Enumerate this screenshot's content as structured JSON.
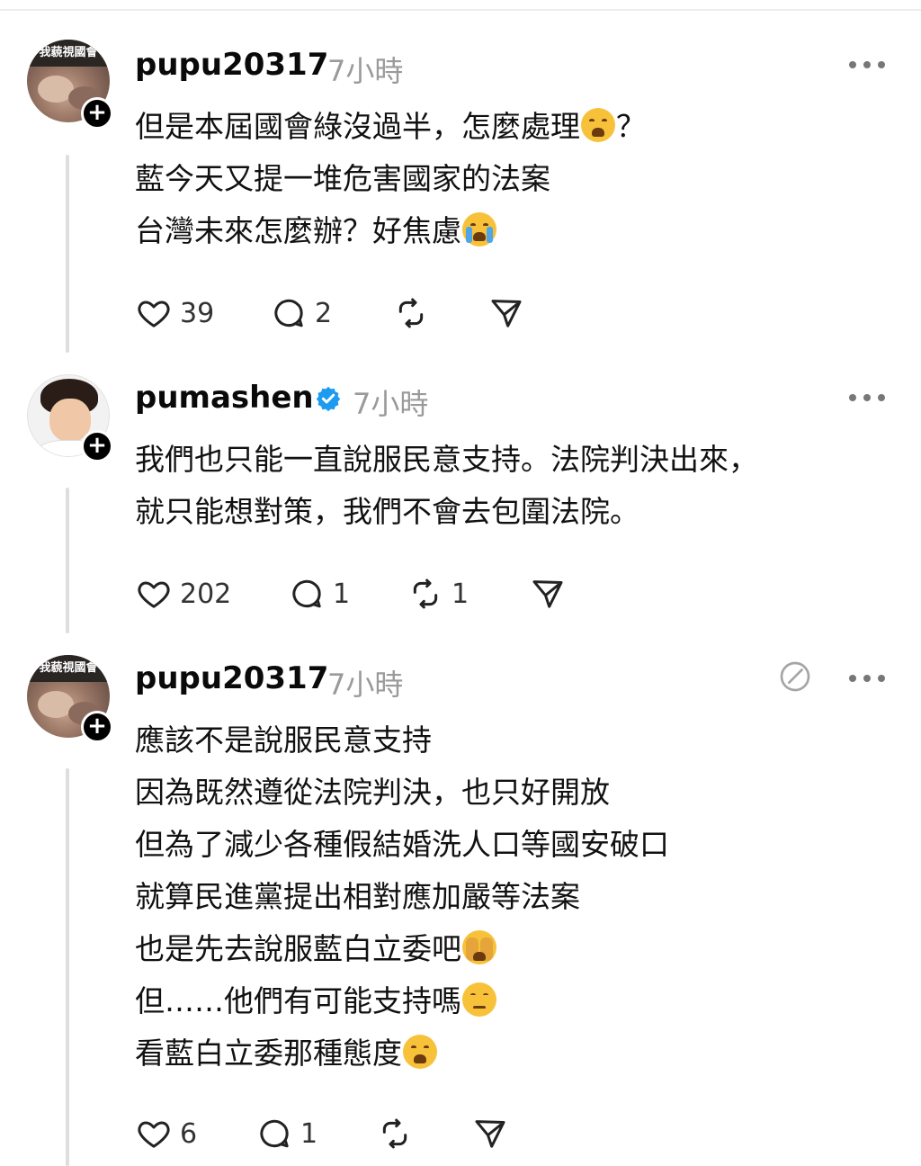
{
  "posts": [
    {
      "username": "pupu20317",
      "time": "7小時",
      "avatar_text": "我藐視國會",
      "lines": [
        {
          "text": "但是本屆國會綠沒過半，怎麼處理",
          "emoji": "weary-face",
          "after": "？"
        },
        {
          "text": "藍今天又提一堆危害國家的法案",
          "emoji": "",
          "after": ""
        },
        {
          "text": "台灣未來怎麼辦？好焦慮",
          "emoji": "loudly-crying-face",
          "after": ""
        }
      ],
      "likes": "39",
      "replies": "2",
      "reposts": ""
    },
    {
      "username": "pumashen",
      "time": "7小時",
      "verified": true,
      "lines": [
        {
          "text": "我們也只能一直說服民意支持。法院判決出來，",
          "emoji": "",
          "after": ""
        },
        {
          "text": "就只能想對策，我們不會去包圍法院。",
          "emoji": "",
          "after": ""
        }
      ],
      "likes": "202",
      "replies": "1",
      "reposts": "1"
    },
    {
      "username": "pupu20317",
      "time": "7小時",
      "avatar_text": "我藐視國會",
      "lines": [
        {
          "text": "應該不是說服民意支持",
          "emoji": "",
          "after": ""
        },
        {
          "text": "因為既然遵從法院判決，也只好開放",
          "emoji": "",
          "after": ""
        },
        {
          "text": "但為了減少各種假結婚洗人口等國安破口",
          "emoji": "",
          "after": ""
        },
        {
          "text": "就算民進黨提出相對應加嚴等法案",
          "emoji": "",
          "after": ""
        },
        {
          "text": "也是先去說服藍白立委吧",
          "emoji": "face-with-hand-over-eyes",
          "after": ""
        },
        {
          "text": "但……他們有可能支持嗎",
          "emoji": "pensive-face",
          "after": ""
        },
        {
          "text": "看藍白立委那種態度",
          "emoji": "weary-face",
          "after": ""
        }
      ],
      "likes": "6",
      "replies": "1",
      "reposts": ""
    }
  ],
  "colors": {
    "verified": "#1d9bf0",
    "muted": "#9a9a9a",
    "line": "#dedede"
  }
}
